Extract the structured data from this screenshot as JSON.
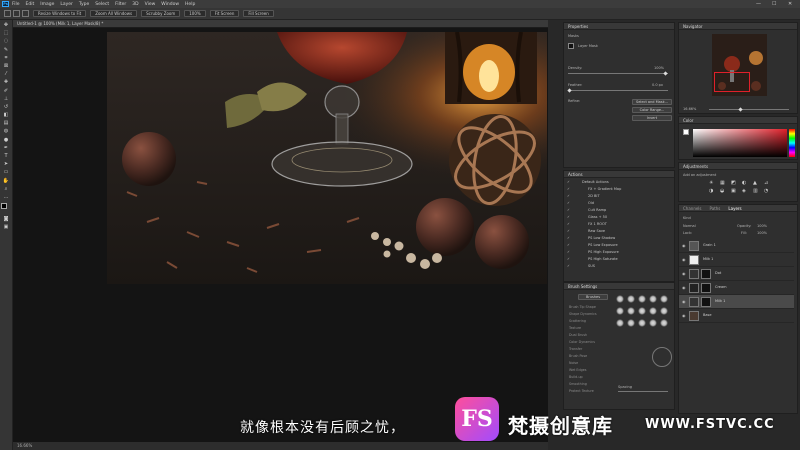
{
  "menubar": {
    "app_icon": "Ps",
    "items": [
      "File",
      "Edit",
      "Image",
      "Layer",
      "Type",
      "Select",
      "Filter",
      "3D",
      "View",
      "Window",
      "Help"
    ],
    "window_controls": [
      "—",
      "☐",
      "✕"
    ]
  },
  "optionsbar": {
    "buttons": [
      "Resize Windows to Fit",
      "Zoom All Windows",
      "Scrubby Zoom",
      "100%",
      "Fit Screen",
      "Fill Screen"
    ]
  },
  "document": {
    "tab_title": "Untitled-1 @ 100% (Milk 1, Layer Mask/8) *",
    "status": "16.66%"
  },
  "properties": {
    "tab": "Properties",
    "section": "Masks",
    "mask_type": "Layer Mask",
    "density_label": "Density:",
    "density_value": "100%",
    "feather_label": "Feather:",
    "feather_value": "0.0 px",
    "refine_label": "Refine:",
    "buttons": [
      "Select and Mask...",
      "Color Range...",
      "Invert"
    ]
  },
  "actions": {
    "tab": "Actions",
    "items": [
      "Default Actions",
      "FX + Gradient Map",
      "2D BIT",
      "Old",
      "Cult Ramp",
      "Glass + 50",
      "FX 1 ROOT",
      "Raw Save",
      "PS Low Shadow",
      "PS Low Exposure",
      "PS High Exposure",
      "PS High Saturate",
      "SUS"
    ]
  },
  "brush_settings": {
    "tab": "Brush Settings",
    "preset_button": "Brushes",
    "items": [
      "Brush Tip Shape",
      "Shape Dynamics",
      "Scattering",
      "Texture",
      "Dual Brush",
      "Color Dynamics",
      "Transfer",
      "Brush Pose",
      "Noise",
      "Wet Edges",
      "Build-up",
      "Smoothing",
      "Protect Texture"
    ],
    "spacing_label": "Spacing"
  },
  "navigator": {
    "tab": "Navigator",
    "zoom": "16.66%"
  },
  "color": {
    "tab": "Color",
    "accent": "#e0202a"
  },
  "adjustments": {
    "tab": "Adjustments",
    "hint": "Add an adjustment"
  },
  "layers": {
    "tabs": [
      "Layers",
      "Channels",
      "Paths"
    ],
    "kind_label": "Kind",
    "blend_mode": "Normal",
    "opacity_label": "Opacity:",
    "opacity_value": "100%",
    "lock_label": "Lock:",
    "fill_label": "Fill:",
    "fill_value": "100%",
    "items": [
      {
        "name": "Grain 1"
      },
      {
        "name": "Milk 1"
      },
      {
        "name": "Dot"
      },
      {
        "name": "Cream"
      },
      {
        "name": "Milk 1"
      },
      {
        "name": "Base"
      }
    ]
  },
  "overlay": {
    "subtitle": "就像根本没有后顾之忧，",
    "logo_text": "FS",
    "brand_name": "梵摄创意库",
    "brand_url": "WWW.FSTVC.CC"
  }
}
